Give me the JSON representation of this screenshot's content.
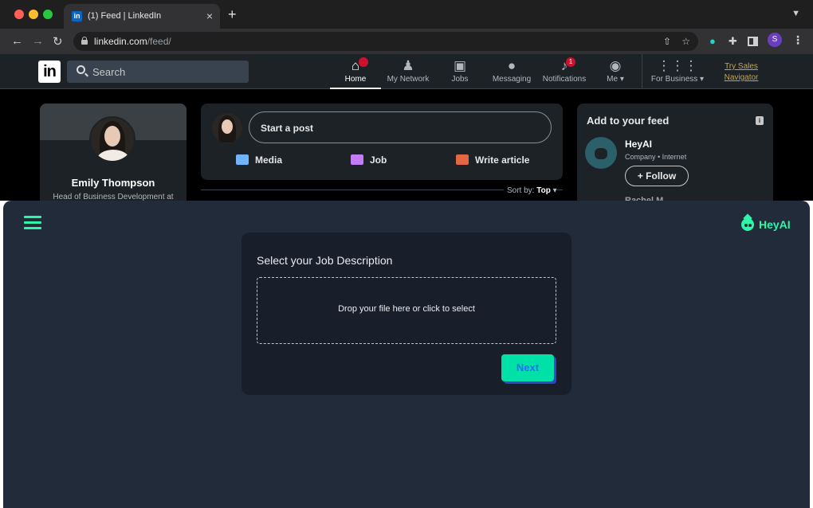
{
  "browser": {
    "tab_title": "(1) Feed | LinkedIn",
    "tab_favicon": "in",
    "url_host": "linkedin.com",
    "url_path": "/feed/",
    "profile_initial": "S"
  },
  "linkedin": {
    "search_placeholder": "Search",
    "nav": [
      {
        "label": "Home",
        "badge": ""
      },
      {
        "label": "My Network",
        "badge": ""
      },
      {
        "label": "Jobs",
        "badge": ""
      },
      {
        "label": "Messaging",
        "badge": ""
      },
      {
        "label": "Notifications",
        "badge": "1"
      },
      {
        "label": "Me",
        "badge": ""
      },
      {
        "label": "For Business",
        "badge": ""
      }
    ],
    "try_sales": "Try Sales Navigator",
    "profile": {
      "name": "Emily Thompson",
      "title": "Head of Business Development at"
    },
    "post": {
      "start_post": "Start a post",
      "media": "Media",
      "job": "Job",
      "write_article": "Write article"
    },
    "sort": {
      "label": "Sort by:",
      "value": "Top"
    },
    "feed": {
      "title": "Add to your feed",
      "item_name": "HeyAI",
      "item_sub": "Company • Internet",
      "follow": "+ Follow",
      "next_item": "Rachel M..."
    }
  },
  "heyai": {
    "brand": "HeyAI",
    "card_title": "Select your Job Description",
    "dropzone_text": "Drop your file here or click to select",
    "next_button": "Next",
    "accent_color": "#2ef5a7"
  }
}
